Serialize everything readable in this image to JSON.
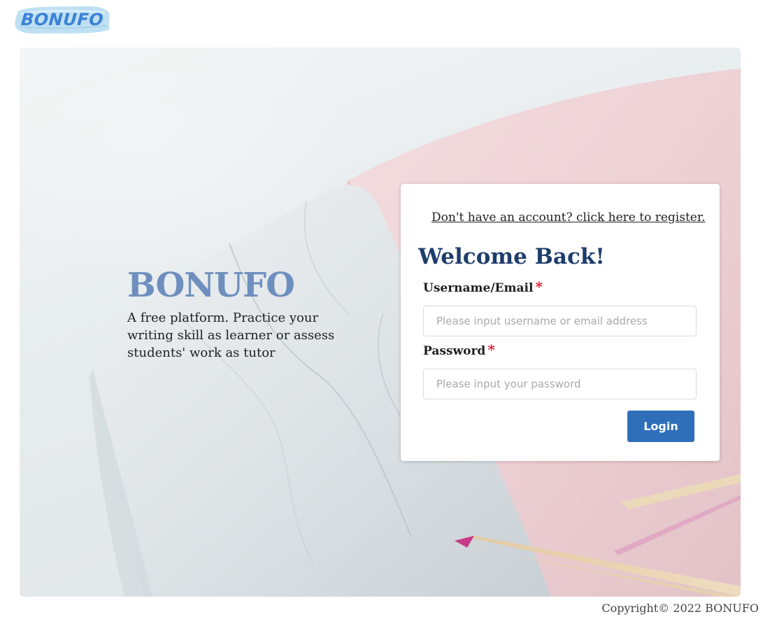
{
  "header": {
    "logo_text": "BONUFO"
  },
  "hero": {
    "brand_title": "BONUFO",
    "brand_description": "A free platform. Practice your writing skill as learner or assess students' work as tutor"
  },
  "login_card": {
    "register_link": "Don't have an account? click here to register.",
    "welcome_title": "Welcome Back!",
    "username_label": "Username/Email",
    "username_placeholder": "Please input username or email address",
    "username_value": "",
    "password_label": "Password",
    "password_placeholder": "Please input your password",
    "password_value": "",
    "required_marker": "*",
    "login_button": "Login"
  },
  "footer": {
    "copyright": "Copyright© 2022 BONUFO"
  },
  "colors": {
    "brand_accent": "#6e8fbe",
    "heading": "#1e3d6b",
    "primary_button": "#2f6fba",
    "required": "#e0192b",
    "logo": "#3b82d6"
  }
}
